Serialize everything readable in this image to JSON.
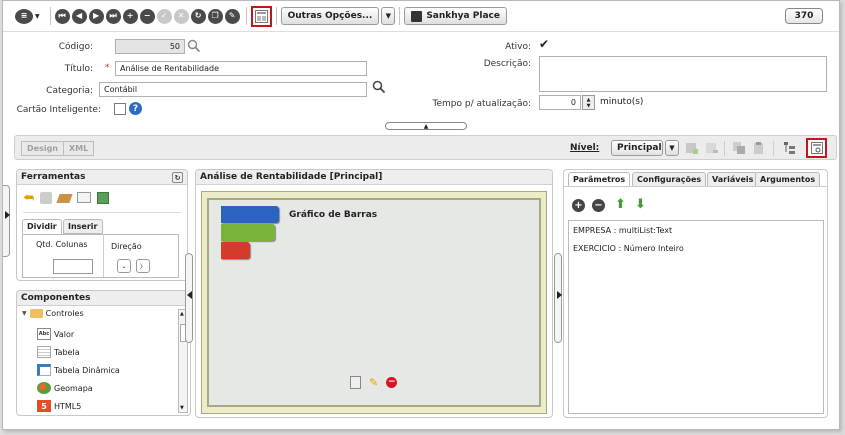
{
  "toolbar": {
    "buttons": [
      "menu",
      "first",
      "previous",
      "next",
      "last",
      "add",
      "remove",
      "confirm",
      "cancel",
      "refresh",
      "copy",
      "edit"
    ],
    "outras_label": "Outras Opções...",
    "sankhya_label": "Sankhya Place",
    "record_count": "370"
  },
  "form": {
    "codigo_label": "Código:",
    "codigo_value": "50",
    "titulo_label": "Título:",
    "required_mark": "*",
    "titulo_value": "Análise de Rentabilidade",
    "categoria_label": "Categoria:",
    "categoria_value": "Contábil",
    "cartao_label": "Cartão Inteligente:",
    "ativo_label": "Ativo:",
    "ativo_checked": true,
    "descricao_label": "Descrição:",
    "descricao_value": "",
    "tempo_label": "Tempo p/ atualização:",
    "tempo_value": "0",
    "tempo_unit": "minuto(s)"
  },
  "designbar": {
    "design_label": "Design",
    "xml_label": "XML",
    "nivel_label": "Nível:",
    "nivel_value": "Principal"
  },
  "ferramentas": {
    "title": "Ferramentas",
    "tab_dividir": "Dividir",
    "tab_inserir": "Inserir",
    "qtd_colunas_label": "Qtd. Colunas",
    "direcao_label": "Direção"
  },
  "componentes": {
    "title": "Componentes",
    "items": [
      {
        "label": "Controles",
        "icon": "folder-icon"
      },
      {
        "label": "Valor",
        "icon": "abc-icon"
      },
      {
        "label": "Tabela",
        "icon": "table-icon"
      },
      {
        "label": "Tabela Dinâmica",
        "icon": "pivot-table-icon"
      },
      {
        "label": "Geomapa",
        "icon": "map-icon"
      },
      {
        "label": "HTML5",
        "icon": "html5-icon"
      }
    ]
  },
  "canvas": {
    "title": "Análise de Rentabilidade [Principal]",
    "component_title": "Gráfico de Barras"
  },
  "params": {
    "tabs": [
      "Parâmetros",
      "Configurações",
      "Variáveis",
      "Argumentos"
    ],
    "items": [
      "EMPRESA : multiList:Text",
      "EXERCICIO : Número Inteiro"
    ]
  },
  "colors": {
    "accent_red": "#c0161c",
    "bar_blue": "#2a64c0",
    "bar_green": "#79b33a",
    "bar_red": "#d33b2a"
  }
}
